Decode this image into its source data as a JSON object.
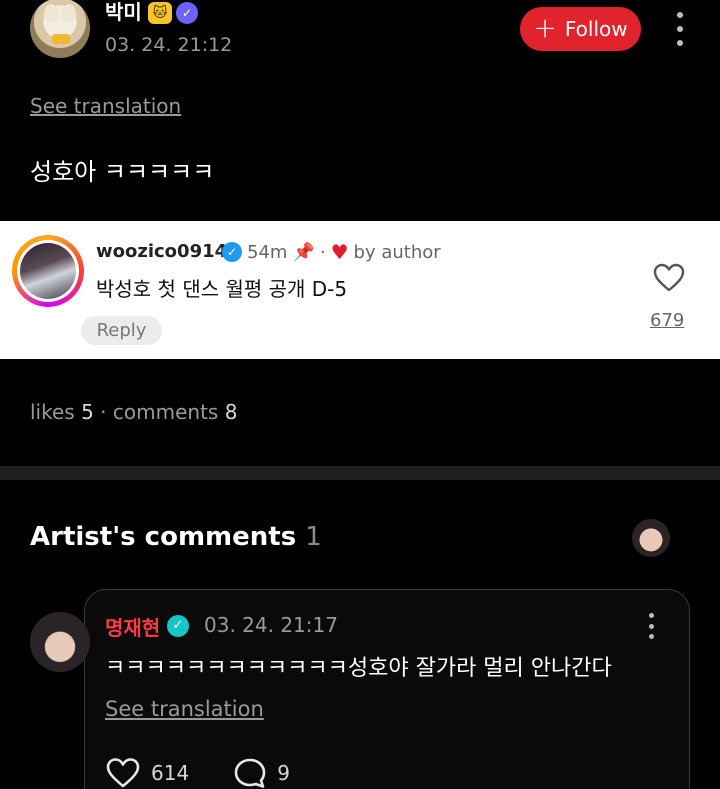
{
  "post": {
    "author_name": "박미",
    "badge_emoji": "🐱",
    "timestamp": "03. 24. 21:12",
    "follow_label": "Follow",
    "see_translation": "See translation",
    "body": "성호아 ㅋㅋㅋㅋㅋ"
  },
  "pinned_comment": {
    "username": "woozico0914",
    "age": "54m",
    "separator": "·",
    "liked_by": "by author",
    "text": "박성호 첫 댄스 월평 공개 D-5",
    "reply_label": "Reply",
    "likes": "679"
  },
  "stats": {
    "likes_label": "likes",
    "likes": "5",
    "separator": "·",
    "comments_label": "comments",
    "comments": "8"
  },
  "artist_comments": {
    "title": "Artist's comments",
    "count": "1",
    "comment": {
      "name": "명재현",
      "timestamp": "03. 24. 21:17",
      "text": "ㅋㅋㅋㅋㅋㅋㅋㅋㅋㅋㅋㅋ성호야 잘가라 멀리 안나간다",
      "see_translation": "See translation",
      "likes": "614",
      "replies": "9"
    }
  },
  "colors": {
    "follow_bg": "#e0232d",
    "artist_name": "#ff3b45",
    "verified_blue": "#1e9bf0"
  }
}
